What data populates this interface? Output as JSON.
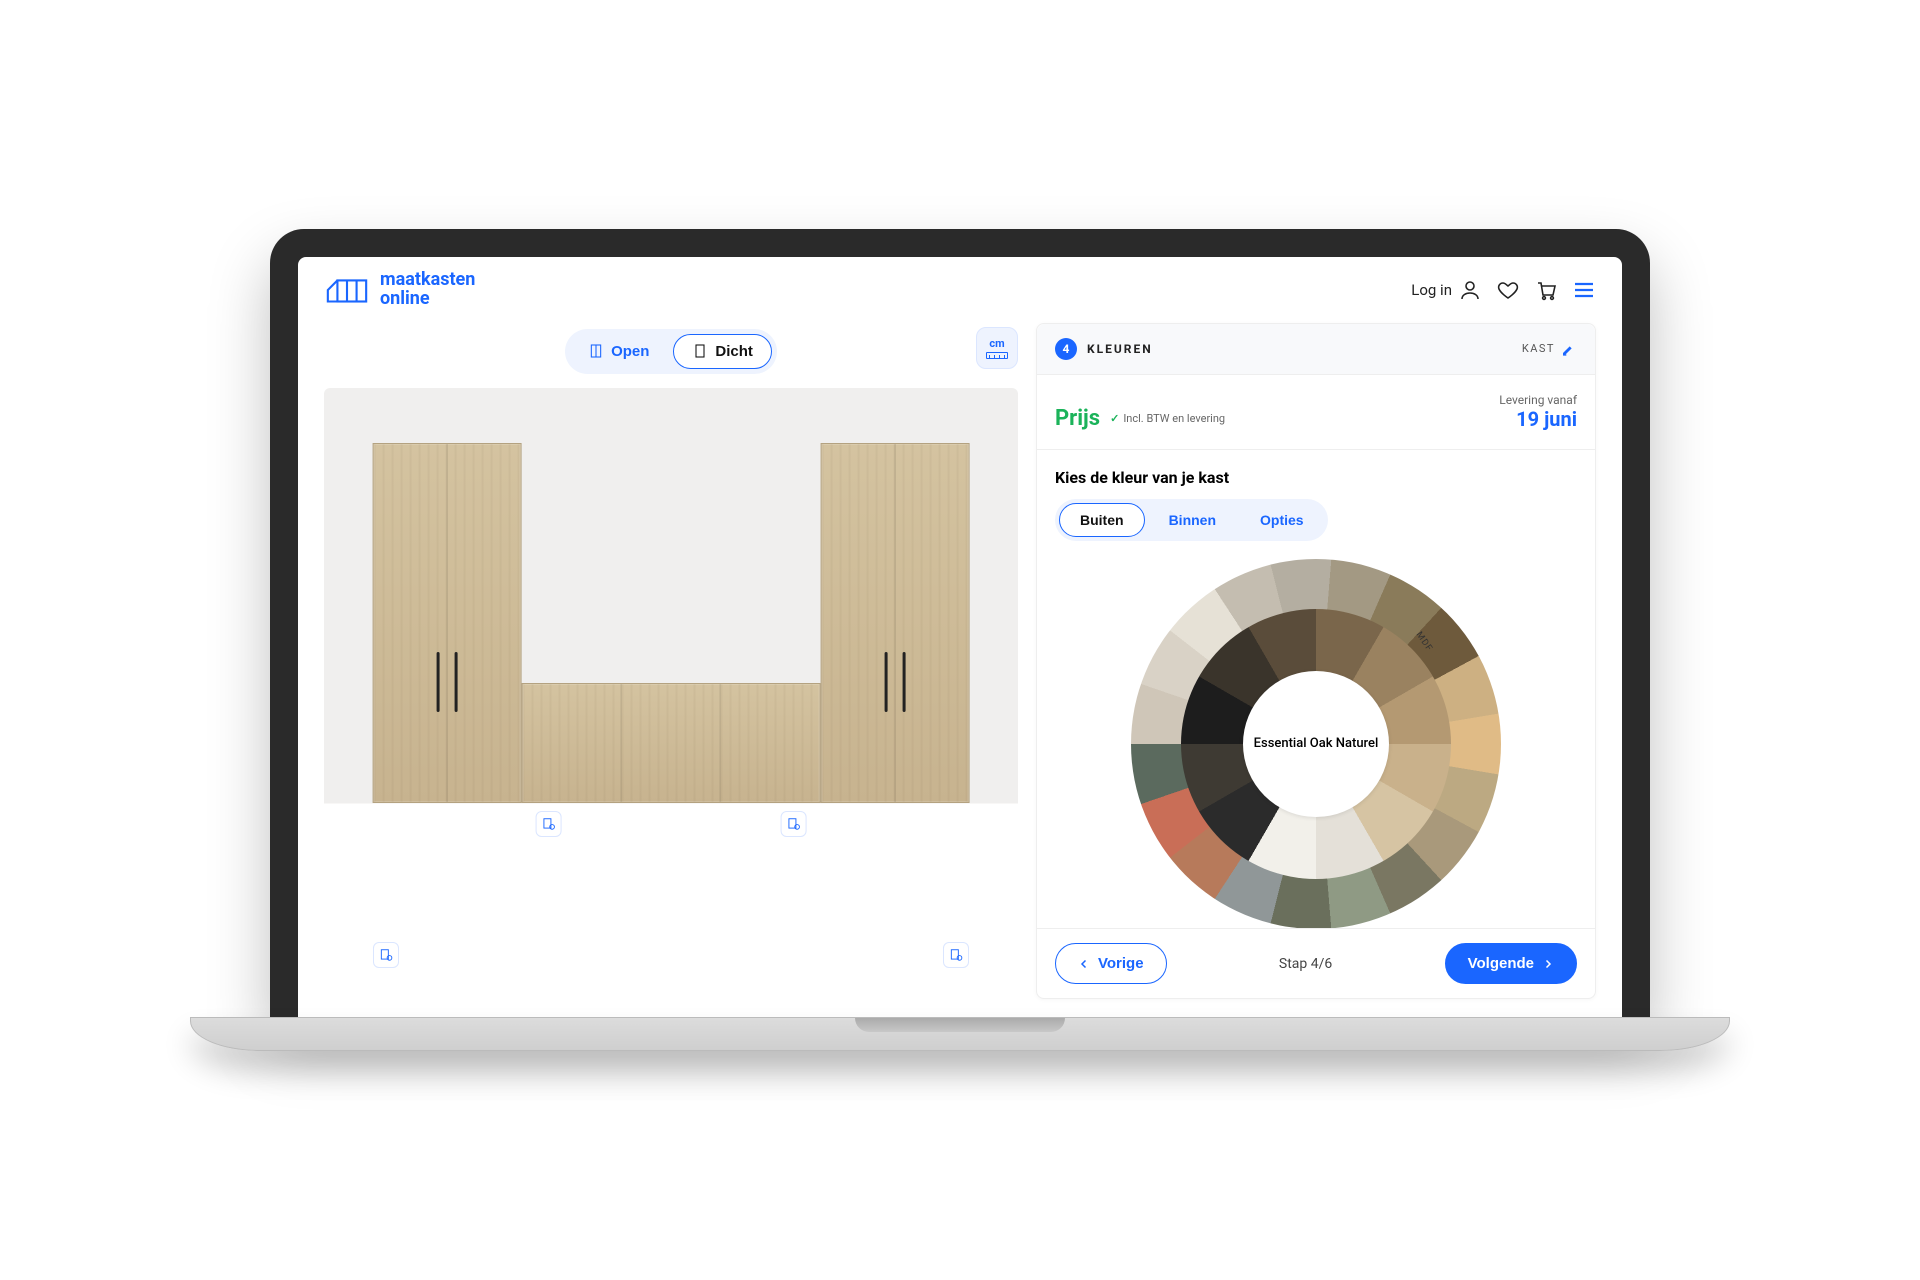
{
  "brand": {
    "line1": "maatkasten",
    "line2": "online"
  },
  "header": {
    "login": "Log in"
  },
  "viewer": {
    "tabs": {
      "open": "Open",
      "closed": "Dicht"
    },
    "measure_unit": "cm"
  },
  "sidebar": {
    "step_number": "4",
    "step_label": "KLEUREN",
    "edit_label": "KAST",
    "price_label": "Prijs",
    "price_meta": "Incl. BTW en levering",
    "delivery_label": "Levering vanaf",
    "delivery_date": "19 juni",
    "body_title": "Kies de kleur van je kast",
    "subtabs": {
      "outside": "Buiten",
      "inside": "Binnen",
      "options": "Opties"
    },
    "color_wheel": {
      "outer": [
        "#cfc6b8",
        "#d9d2c6",
        "#e6e1d6",
        "#c4bdb0",
        "#b4aea1",
        "#a39983",
        "#8a7b5a",
        "#6e5a3c",
        "#cdb082",
        "#e0bb86",
        "#bca982",
        "#a9997b",
        "#7a7762",
        "#8f9a84",
        "#6a6f5c",
        "#909798",
        "#b77a5b",
        "#c96e57",
        "#5b6a5e"
      ],
      "inner": [
        "#1d1d1d",
        "#3a342b",
        "#5a4c3a",
        "#7a664b",
        "#9a8260",
        "#b49972",
        "#c9b18b",
        "#d6c4a3",
        "#e4e0d8",
        "#f2f0ea",
        "#2b2b2b",
        "#3e3a33"
      ],
      "selected_name": "Essential Oak Naturel",
      "mdf_label": "MDF"
    },
    "footer": {
      "prev": "Vorige",
      "next": "Volgende",
      "step": "Stap 4/6"
    }
  }
}
